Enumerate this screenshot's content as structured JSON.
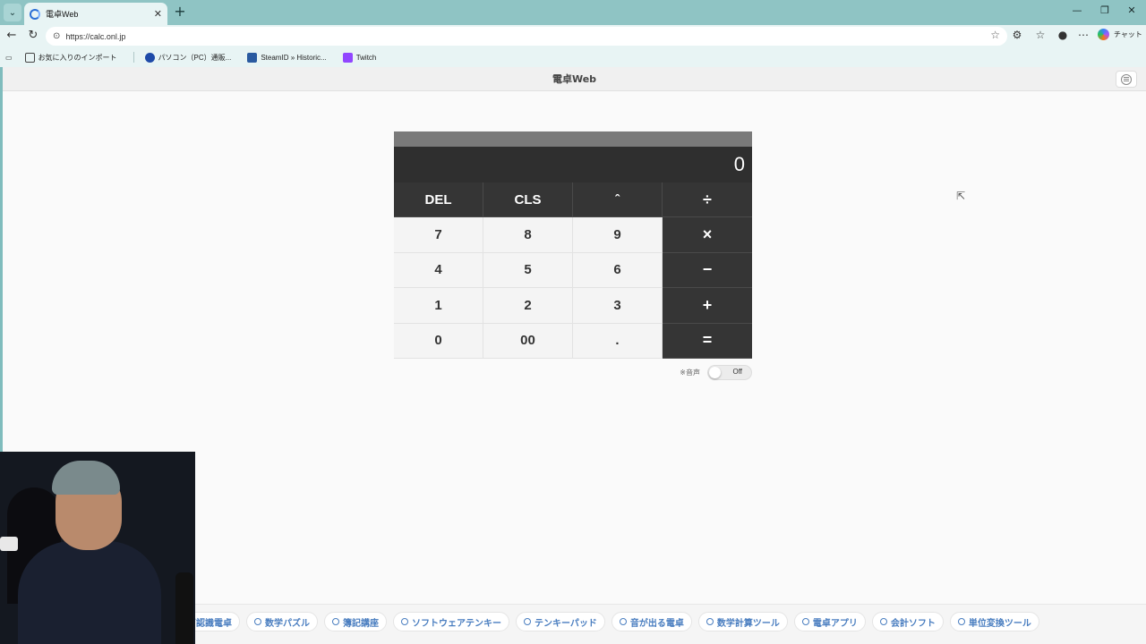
{
  "browser": {
    "tab_title": "電卓Web",
    "url": "https://calc.onl.jp",
    "chat_label": "チャット",
    "bookmarks": [
      {
        "label": "お気に入りのインポート",
        "icon": "folder-icon"
      },
      {
        "label": "パソコン（PC）通販...",
        "icon": "shop-icon"
      },
      {
        "label": "SteamID » Historic...",
        "icon": "steam-icon"
      },
      {
        "label": "Twitch",
        "icon": "twitch-icon"
      }
    ]
  },
  "site": {
    "title": "電卓Web"
  },
  "calculator": {
    "display_value": "0",
    "keys": [
      {
        "label": "DEL",
        "style": "dark"
      },
      {
        "label": "CLS",
        "style": "dark"
      },
      {
        "label": "ˆ",
        "style": "dark"
      },
      {
        "label": "÷",
        "style": "op"
      },
      {
        "label": "7",
        "style": "light"
      },
      {
        "label": "8",
        "style": "light"
      },
      {
        "label": "9",
        "style": "light"
      },
      {
        "label": "×",
        "style": "op"
      },
      {
        "label": "4",
        "style": "light"
      },
      {
        "label": "5",
        "style": "light"
      },
      {
        "label": "6",
        "style": "light"
      },
      {
        "label": "−",
        "style": "op"
      },
      {
        "label": "1",
        "style": "light"
      },
      {
        "label": "2",
        "style": "light"
      },
      {
        "label": "3",
        "style": "light"
      },
      {
        "label": "+",
        "style": "op"
      },
      {
        "label": "0",
        "style": "light"
      },
      {
        "label": "00",
        "style": "light"
      },
      {
        "label": ".",
        "style": "light"
      },
      {
        "label": "=",
        "style": "op"
      }
    ],
    "sound_label": "※音声",
    "sound_state": "Off"
  },
  "footer_links": [
    "声認識電卓",
    "数学パズル",
    "簿記講座",
    "ソフトウェアテンキー",
    "テンキーパッド",
    "音が出る電卓",
    "数学計算ツール",
    "電卓アプリ",
    "会計ソフト",
    "単位変換ツール"
  ],
  "colors": {
    "display_bg": "#2f2f2f",
    "dark_key": "#353535",
    "light_key": "#f4f4f4",
    "link": "#4a7ec0",
    "browser_frame": "#8fc4c4"
  }
}
